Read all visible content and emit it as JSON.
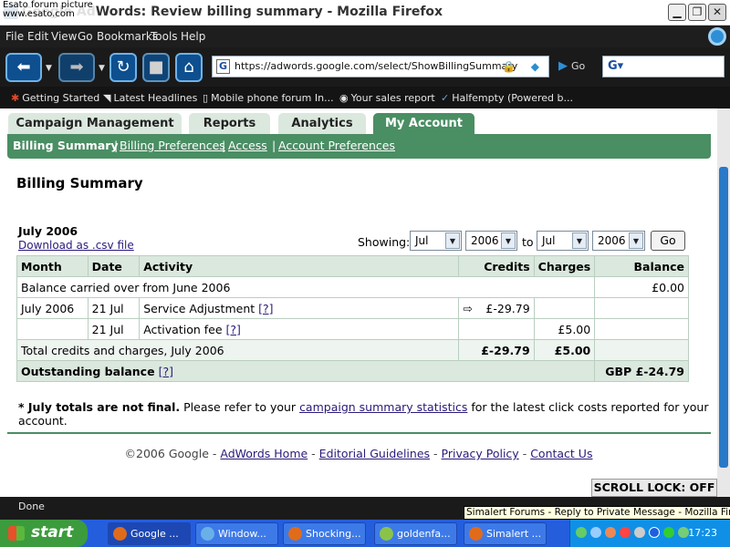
{
  "window": {
    "title": "Google AdWords: Review billing summary - Mozilla Firefox",
    "watermark_line1": "Esato forum picture",
    "watermark_line2": "www.esato.com"
  },
  "menu": [
    "File",
    "Edit",
    "View",
    "Go",
    "Bookmarks",
    "Tools",
    "Help"
  ],
  "nav": {
    "url": "https://adwords.google.com/select/ShowBillingSummary",
    "go_label": "Go"
  },
  "bookmarks": [
    {
      "label": "Getting Started",
      "icon": "bookmark-icon"
    },
    {
      "label": "Latest Headlines",
      "icon": "rss-icon"
    },
    {
      "label": "Mobile phone forum In...",
      "icon": "phone-icon"
    },
    {
      "label": "Your sales report",
      "icon": "globe-icon"
    },
    {
      "label": "Halfempty (Powered b...",
      "icon": "bookmark-icon"
    }
  ],
  "tabs": [
    {
      "label": "Campaign Management",
      "active": false
    },
    {
      "label": "Reports",
      "active": false
    },
    {
      "label": "Analytics",
      "active": false
    },
    {
      "label": "My Account",
      "active": true
    }
  ],
  "subnav": {
    "current": "Billing Summary",
    "links": [
      "Billing Preferences",
      "Access",
      "Account Preferences"
    ],
    "separator": "|"
  },
  "page": {
    "title": "Billing Summary",
    "period": "July 2006",
    "download_link": "Download as .csv file",
    "showing_label": "Showing:",
    "from_month": "Jul",
    "from_year": "2006",
    "to_label": "to",
    "to_month": "Jul",
    "to_year": "2006",
    "go_button": "Go"
  },
  "table": {
    "headers": {
      "month": "Month",
      "date": "Date",
      "activity": "Activity",
      "credits": "Credits",
      "charges": "Charges",
      "balance": "Balance"
    },
    "carried_over": {
      "label": "Balance carried over from June 2006",
      "balance": "£0.00"
    },
    "rows": [
      {
        "month": "July 2006",
        "date": "21 Jul",
        "activity": "Service Adjustment",
        "help": "[?]",
        "arrow": "⇨",
        "credits": "£-29.79",
        "charges": "",
        "balance": ""
      },
      {
        "month": "",
        "date": "21 Jul",
        "activity": "Activation fee",
        "help": "[?]",
        "arrow": "",
        "credits": "",
        "charges": "£5.00",
        "balance": ""
      }
    ],
    "total": {
      "label": "Total credits and charges, July 2006",
      "credits": "£-29.79",
      "charges": "£5.00"
    },
    "outstanding": {
      "label": "Outstanding balance",
      "help": "[?]",
      "balance": "GBP £-24.79"
    }
  },
  "note": {
    "prefix": "* July totals are not final.",
    "text1": "Please refer to your",
    "link": "campaign summary statistics",
    "text2": "for the latest click costs reported for your account."
  },
  "footer": {
    "copyright": "©2006 Google",
    "links": [
      "AdWords Home",
      "Editorial Guidelines",
      "Privacy Policy",
      "Contact Us"
    ],
    "separator": "-"
  },
  "scroll_lock": "SCROLL LOCK: OFF",
  "status": {
    "text": "Done",
    "tooltip": "Simalert Forums - Reply to Private Message - Mozilla Firefox"
  },
  "taskbar": {
    "start": "start",
    "tasks": [
      {
        "label": "Google ...",
        "active": true
      },
      {
        "label": "Window...",
        "active": false
      },
      {
        "label": "Shocking...",
        "active": false
      },
      {
        "label": "goldenfa...",
        "active": false
      },
      {
        "label": "Simalert ...",
        "active": false
      }
    ],
    "clock": "17:23"
  },
  "colors": {
    "accent_green": "#4a8e63",
    "tab_light": "#dbe8de",
    "link": "#2a1a7a",
    "taskbar_blue": "#245edc"
  }
}
